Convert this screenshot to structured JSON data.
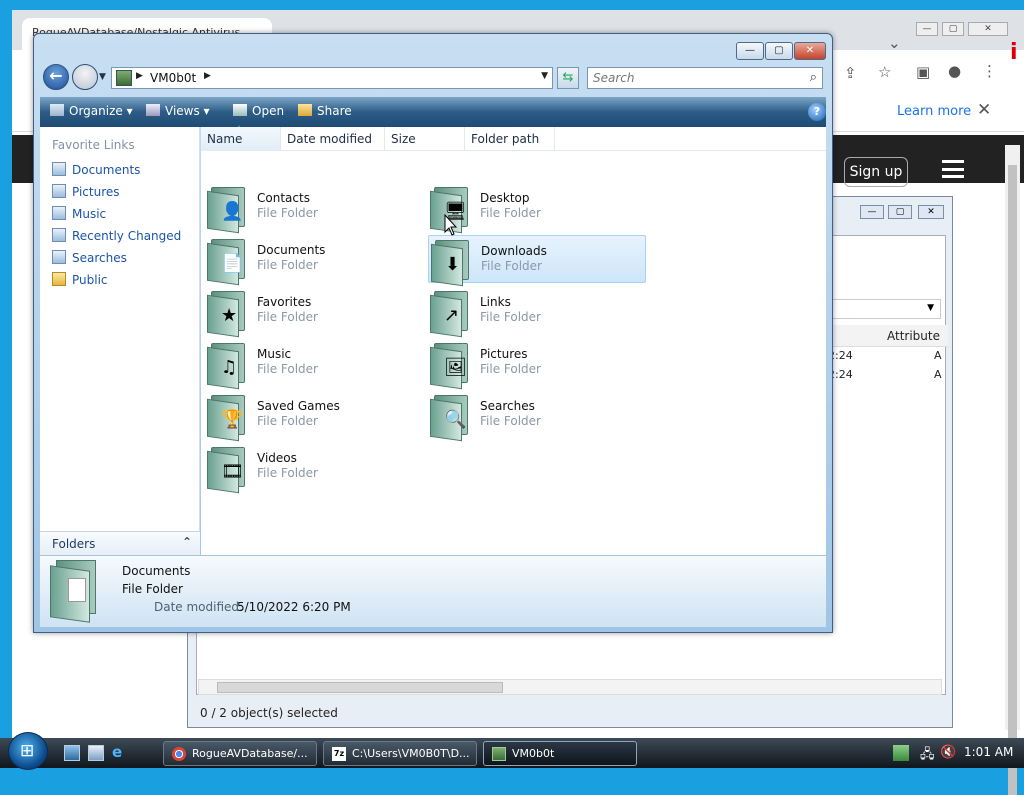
{
  "browser": {
    "tab_title": "RogueAVDatabase/Nostalgic Antivirus",
    "info_learn_more": "Learn more",
    "info_close": "✕",
    "signup_label": "Sign up",
    "side_glyph": "i"
  },
  "zip_window": {
    "column_attributes": "Attribute",
    "row_times": [
      "2:24",
      "2:24"
    ],
    "row_attr": [
      "A",
      "A"
    ],
    "status": "0 / 2 object(s) selected"
  },
  "explorer": {
    "address_path": "VM0b0t",
    "search_placeholder": "Search",
    "commands": {
      "organize": "Organize",
      "views": "Views",
      "open": "Open",
      "share": "Share",
      "help": "?"
    },
    "nav": {
      "header": "Favorite Links",
      "items": [
        {
          "label": "Documents"
        },
        {
          "label": "Pictures"
        },
        {
          "label": "Music"
        },
        {
          "label": "Recently Changed"
        },
        {
          "label": "Searches"
        },
        {
          "label": "Public"
        }
      ],
      "folders_label": "Folders"
    },
    "columns": [
      "Name",
      "Date modified",
      "Size",
      "Folder path"
    ],
    "items": [
      {
        "name": "Contacts",
        "type": "File Folder",
        "icon": "contacts-icon",
        "glyph": "👤"
      },
      {
        "name": "Desktop",
        "type": "File Folder",
        "icon": "desktop-icon",
        "glyph": "🖥"
      },
      {
        "name": "Documents",
        "type": "File Folder",
        "icon": "documents-icon",
        "glyph": "📄"
      },
      {
        "name": "Downloads",
        "type": "File Folder",
        "icon": "downloads-icon",
        "glyph": "⬇"
      },
      {
        "name": "Favorites",
        "type": "File Folder",
        "icon": "favorites-icon",
        "glyph": "★"
      },
      {
        "name": "Links",
        "type": "File Folder",
        "icon": "links-icon",
        "glyph": "↗"
      },
      {
        "name": "Music",
        "type": "File Folder",
        "icon": "music-icon",
        "glyph": "♫"
      },
      {
        "name": "Pictures",
        "type": "File Folder",
        "icon": "pictures-icon",
        "glyph": "🖼"
      },
      {
        "name": "Saved Games",
        "type": "File Folder",
        "icon": "saved-games-icon",
        "glyph": "🏆"
      },
      {
        "name": "Searches",
        "type": "File Folder",
        "icon": "searches-icon",
        "glyph": "🔍"
      },
      {
        "name": "Videos",
        "type": "File Folder",
        "icon": "videos-icon",
        "glyph": "🎞"
      }
    ],
    "selected_item": "Downloads",
    "details": {
      "name": "Documents",
      "type": "File Folder",
      "modified_label": "Date modified:",
      "modified_value": "5/10/2022 6:20 PM"
    }
  },
  "taskbar": {
    "buttons": [
      {
        "label": "RogueAVDatabase/..."
      },
      {
        "label": "C:\\Users\\VM0B0T\\D..."
      },
      {
        "label": "VM0b0t"
      }
    ],
    "clock": "1:01 AM"
  },
  "colors": {
    "desktop": "#1aa0e0",
    "link_blue": "#1c54a6",
    "selection": "#cde6fa"
  }
}
